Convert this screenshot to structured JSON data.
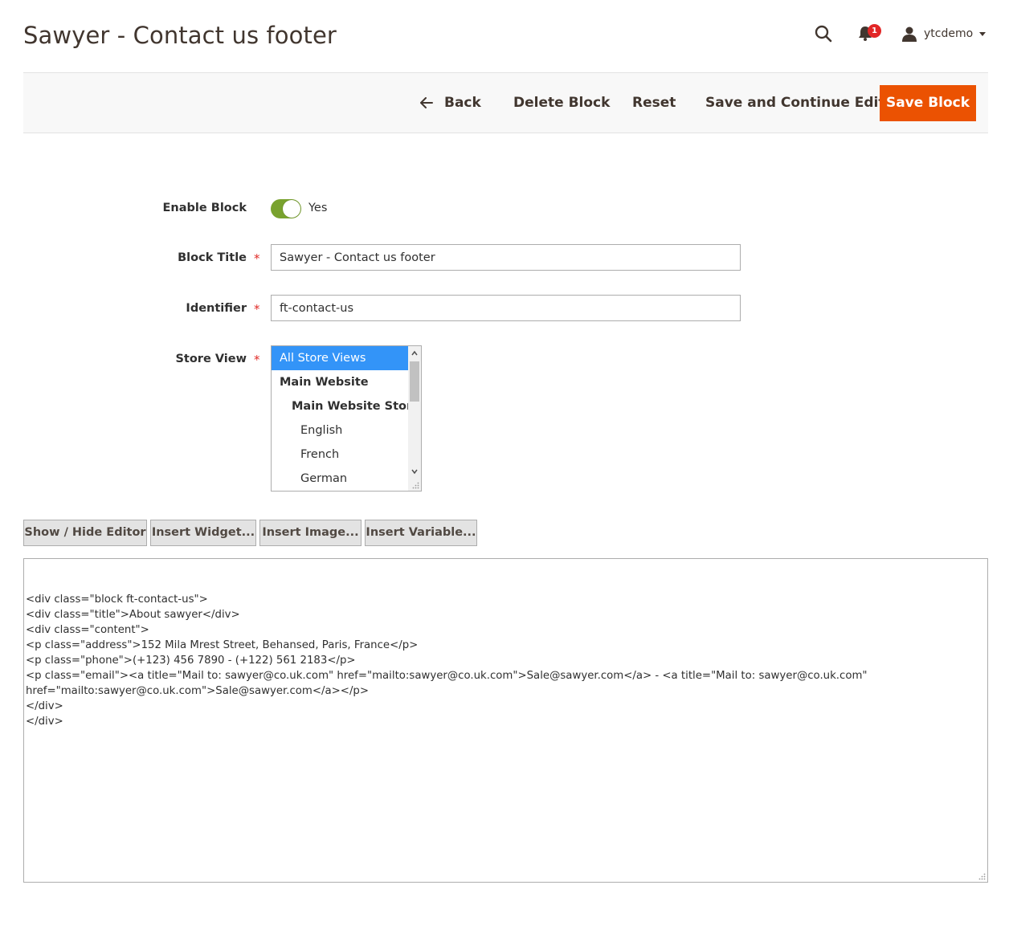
{
  "header": {
    "title": "Sawyer - Contact us footer",
    "notification_count": "1",
    "username": "ytcdemo"
  },
  "actions": {
    "back": "Back",
    "delete": "Delete Block",
    "reset": "Reset",
    "save_continue": "Save and Continue Edit",
    "save": "Save Block"
  },
  "form": {
    "enable_label": "Enable Block",
    "enable_value": "Yes",
    "title_label": "Block Title",
    "title_value": "Sawyer - Contact us footer",
    "identifier_label": "Identifier",
    "identifier_value": "ft-contact-us",
    "store_label": "Store View",
    "required_mark": "*",
    "store_options": [
      "All Store Views",
      "Main Website",
      "Main Website Store",
      "English",
      "French",
      "German"
    ]
  },
  "editor_buttons": {
    "show_hide": "Show / Hide Editor",
    "insert_widget": "Insert Widget...",
    "insert_image": "Insert Image...",
    "insert_variable": "Insert Variable..."
  },
  "content_lines": [
    "<div class=\"block ft-contact-us\">",
    "<div class=\"title\">About sawyer</div>",
    "<div class=\"content\">",
    "<p class=\"address\">152 Mila Mrest Street, Behansed, Paris, France</p>",
    "<p class=\"phone\">(+123) 456 7890 - (+122) 561 2183</p>",
    "<p class=\"email\"><a title=\"Mail to: sawyer@co.uk.com\" href=\"mailto:sawyer@co.uk.com\">Sale@sawyer.com</a> - <a title=\"Mail to: sawyer@co.uk.com\"",
    "href=\"mailto:sawyer@co.uk.com\">Sale@sawyer.com</a></p>",
    "</div>",
    "</div>"
  ],
  "colors": {
    "accent": "#eb5202",
    "toggle_on": "#79a22e",
    "selected_option": "#3394f8",
    "required": "#e02b27"
  }
}
